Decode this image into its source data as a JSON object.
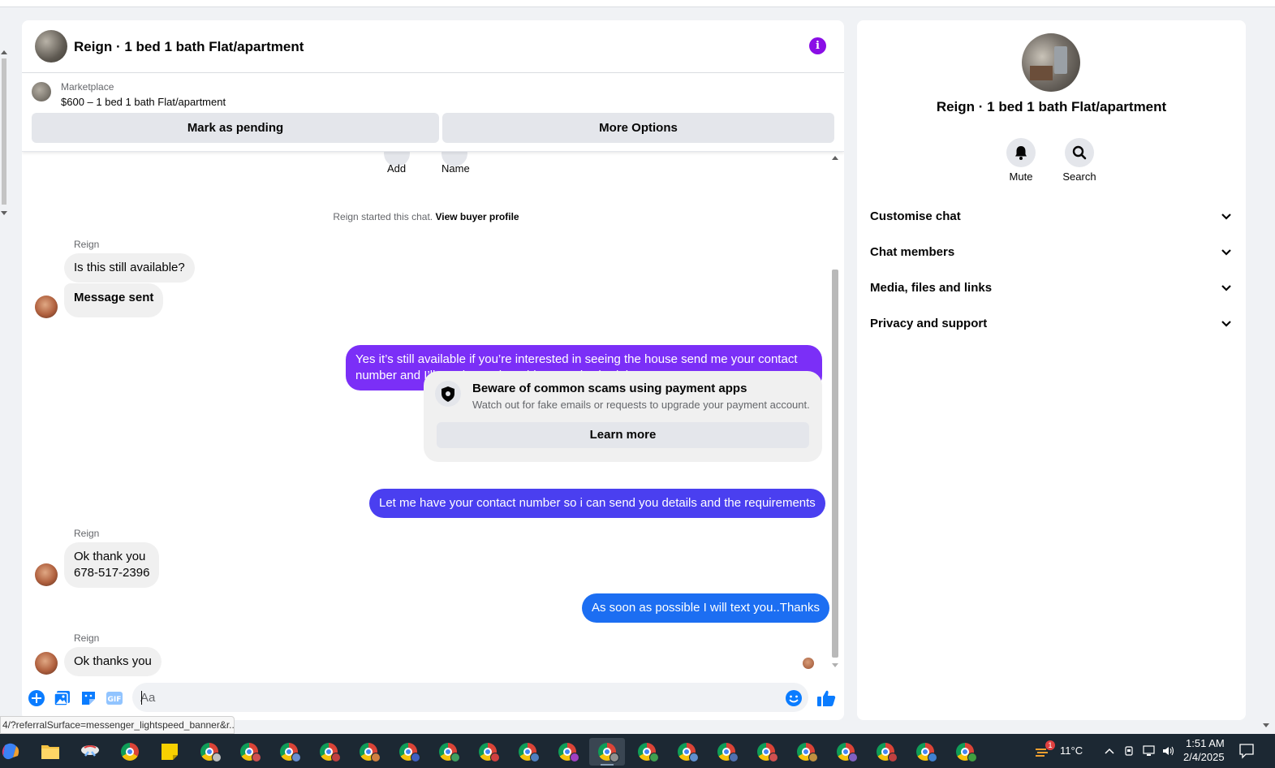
{
  "colors": {
    "accent_purple": "#8a0ee6",
    "bubble_violet": "#7b2ff7",
    "bubble_indigo": "#4a3ff0",
    "bubble_blue": "#1c6ef2",
    "messenger_blue": "#0a7cff"
  },
  "chat": {
    "title": "Reign · 1 bed 1 bath Flat/apartment",
    "info_icon": "info-icon",
    "marketplace": {
      "label": "Marketplace",
      "listing": "$600 – 1 bed 1 bath Flat/apartment",
      "pending_button": "Mark as pending",
      "more_button": "More Options"
    },
    "quick_actions": [
      {
        "label": "Add"
      },
      {
        "label": "Name"
      }
    ],
    "started_text": "Reign started this chat.",
    "view_profile_link": "View buyer profile",
    "messages": [
      {
        "sender": "Reign",
        "lines": [
          "Is this still available?",
          "Message sent"
        ]
      },
      {
        "from": "me",
        "text": "Yes it’s still available if you’re interested in seeing the house send me your contact number and I’ll send over the address and schedule."
      },
      {
        "from": "me",
        "text": "Let me have your contact number so i can send you details and the requirements"
      },
      {
        "sender": "Reign",
        "lines": [
          "Ok thank you",
          "678-517-2396"
        ]
      },
      {
        "from": "me",
        "text": "As soon as possible I will text you..Thanks"
      },
      {
        "sender": "Reign",
        "lines": [
          "Ok thanks you"
        ]
      }
    ],
    "scam_warning": {
      "title": "Beware of common scams using payment apps",
      "text": "Watch out for fake emails or requests to upgrade your payment account.",
      "button": "Learn more"
    },
    "composer": {
      "placeholder": "Aa",
      "icons": [
        "plus-icon",
        "photo-icon",
        "sticker-icon",
        "gif-icon",
        "emoji-icon",
        "thumbs-up-icon"
      ]
    }
  },
  "info_panel": {
    "title": "Reign · 1 bed 1 bath Flat/apartment",
    "actions": [
      {
        "label": "Mute",
        "icon": "bell-icon"
      },
      {
        "label": "Search",
        "icon": "search-icon"
      }
    ],
    "sections": [
      "Customise chat",
      "Chat members",
      "Media, files and links",
      "Privacy and support"
    ]
  },
  "status_url": "4/?referralSurface=messenger_lightspeed_banner&r...",
  "taskbar": {
    "temperature": "11°C",
    "weather_badge": "1",
    "time": "1:51 AM",
    "date": "2/4/2025"
  }
}
